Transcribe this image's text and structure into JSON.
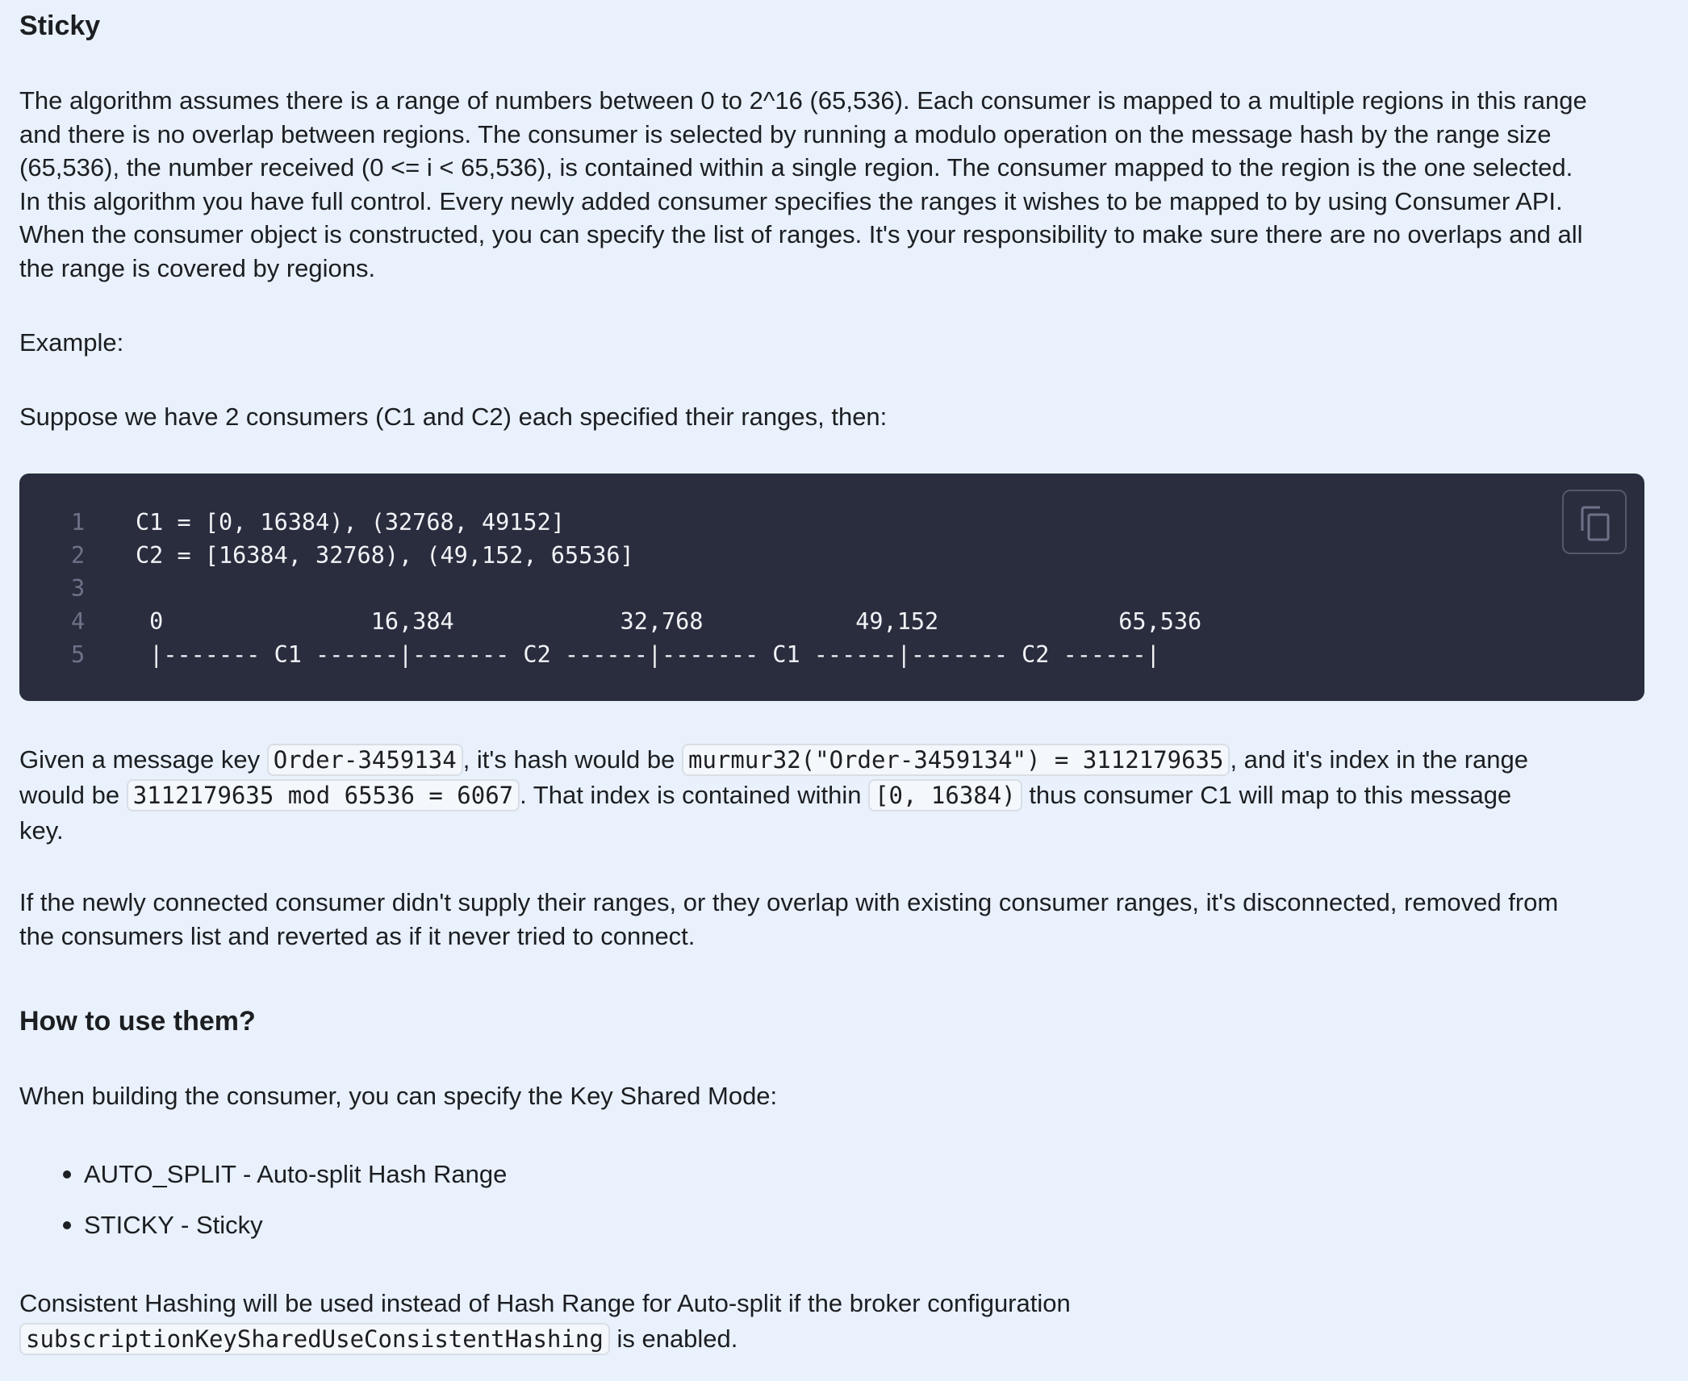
{
  "section_title": "Sticky",
  "intro_lines": [
    "The algorithm assumes there is a range of numbers between 0 to 2^16 (65,536). Each consumer is mapped to a multiple regions in this range",
    "and there is no overlap between regions. The consumer is selected by running a modulo operation on the message hash by the range size",
    "(65,536), the number received (0 <= i < 65,536), is contained within a single region. The consumer mapped to the region is the one selected.",
    "In this algorithm you have full control. Every newly added consumer specifies the ranges it wishes to be mapped to by using Consumer API.",
    "When the consumer object is constructed, you can specify the list of ranges. It's your responsibility to make sure there are no overlaps and all",
    "the range is covered by regions."
  ],
  "example_label": "Example:",
  "suppose_text": "Suppose we have 2 consumers (C1 and C2) each specified their ranges, then:",
  "code": {
    "line_numbers": [
      "1",
      "2",
      "3",
      "4",
      "5"
    ],
    "lines": [
      "C1 = [0, 16384), (32768, 49152]",
      "C2 = [16384, 32768), (49,152, 65536]",
      "",
      " 0               16,384            32,768           49,152             65,536",
      " |------- C1 ------|------- C2 ------|------- C1 ------|------- C2 ------|"
    ],
    "copy_icon": "copy-icon"
  },
  "given": {
    "t1": "Given a message key ",
    "c1": "Order-3459134",
    "t2": ", it's hash would be ",
    "c2": "murmur32(\"Order-3459134\") = 3112179635",
    "t3": ", and it's index in the range",
    "t4": "would be ",
    "c3": "3112179635 mod 65536 = 6067",
    "t5": ". That index is contained within ",
    "c4": "[0, 16384)",
    "t6": " thus consumer C1 will map to this message",
    "t7": "key."
  },
  "newly_lines": [
    "If the newly connected consumer didn't supply their ranges, or they overlap with existing consumer ranges, it's disconnected, removed from",
    "the consumers list and reverted as if it never tried to connect."
  ],
  "howto_title": "How to use them?",
  "building_text": "When building the consumer, you can specify the Key Shared Mode:",
  "modes": [
    "AUTO_SPLIT - Auto-split Hash Range",
    "STICKY - Sticky"
  ],
  "consistent": {
    "t1": "Consistent Hashing will be used instead of Hash Range for Auto-split if the broker configuration",
    "c1": "subscriptionKeySharedUseConsistentHashing",
    "t2": " is enabled."
  }
}
